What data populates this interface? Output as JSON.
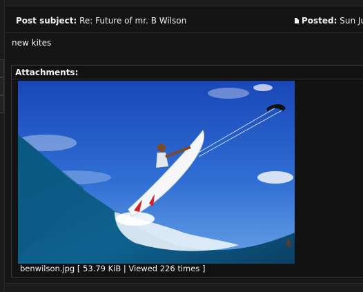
{
  "post": {
    "subject_label": "Post subject:",
    "subject_value": "Re: Future of mr. B Wilson",
    "posted_label": "Posted:",
    "posted_value": "Sun Jun"
  },
  "message": {
    "text": "new kites"
  },
  "attachments": {
    "title": "Attachments:",
    "file": {
      "name": "benwilson.jpg",
      "meta": "[ 53.79 KiB | Viewed 226 times ]"
    }
  },
  "icons": [
    "post-doc-icon"
  ],
  "colors": {
    "background": "#161616",
    "text": "#e6e6e6",
    "box_border": "#3a3a3a"
  }
}
